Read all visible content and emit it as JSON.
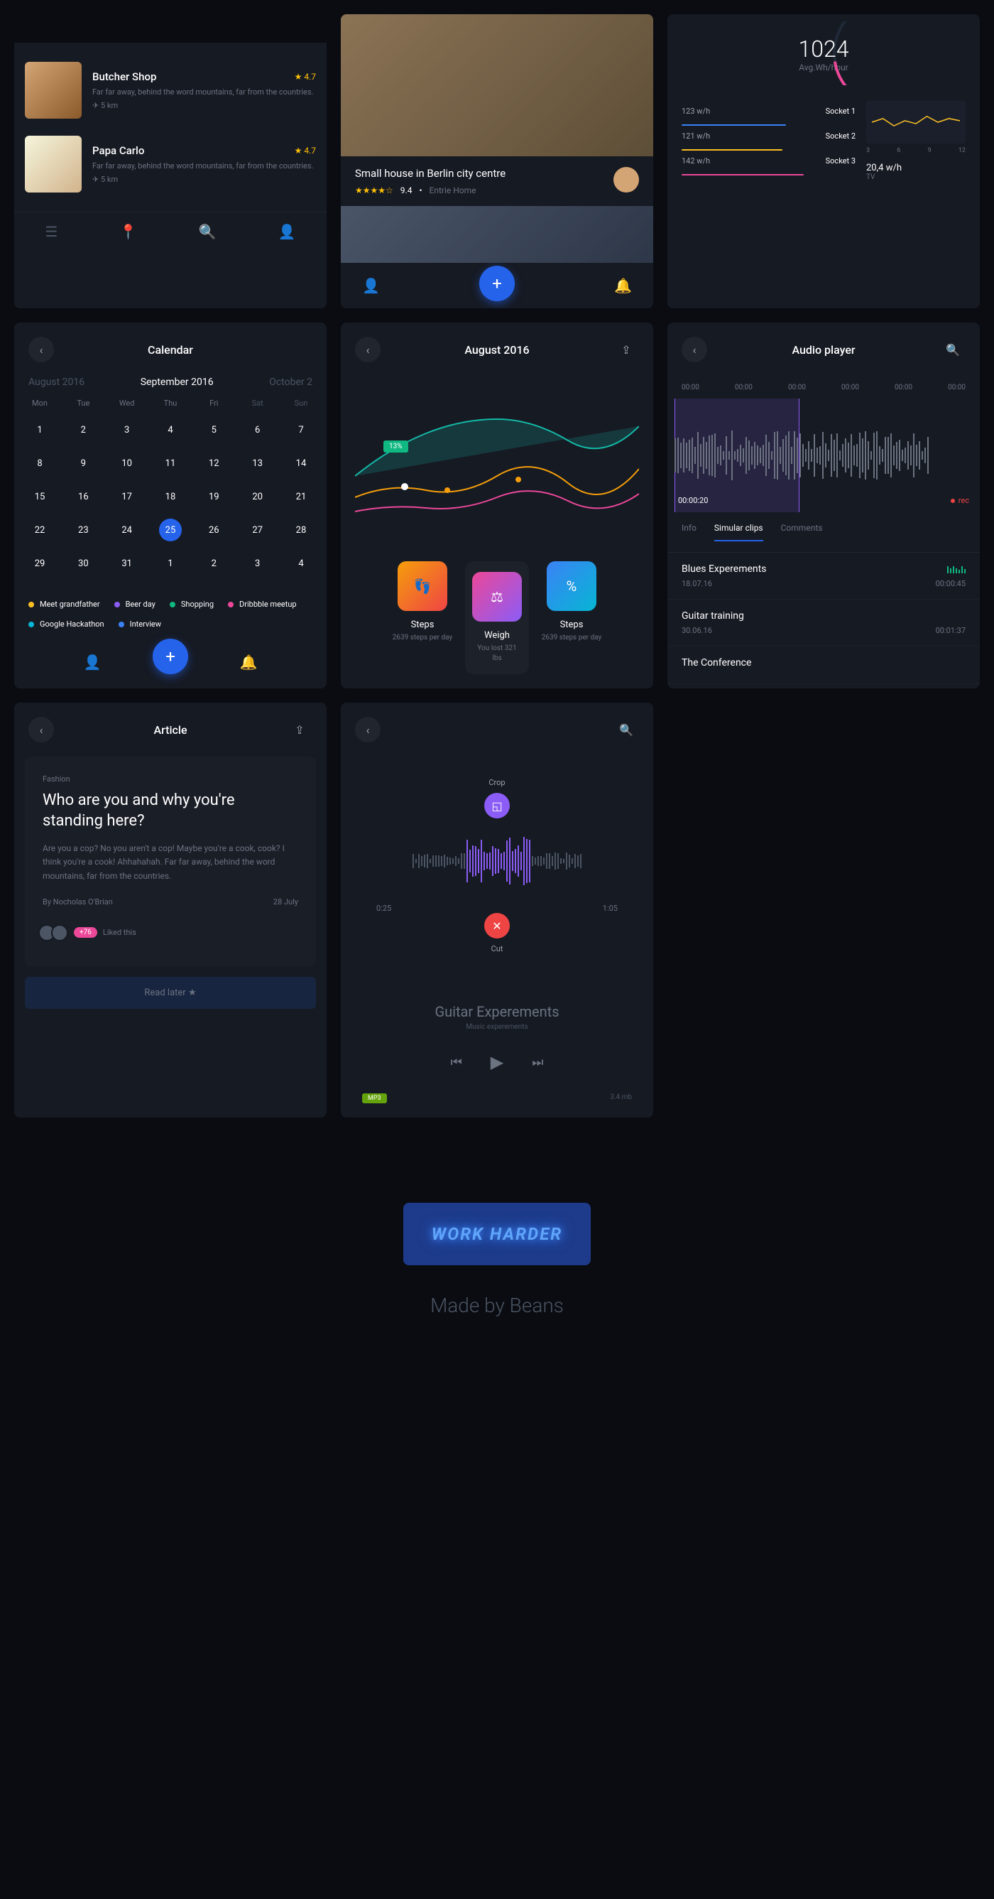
{
  "restaurants": {
    "items": [
      {
        "name": "Butcher Shop",
        "rating": "4.7",
        "desc": "Far far away, behind the word mountains, far from the countries.",
        "dist": "5 km"
      },
      {
        "name": "Papa Carlo",
        "rating": "4.7",
        "desc": "Far far away, behind the word mountains, far from the countries.",
        "dist": "5 km"
      }
    ]
  },
  "house": {
    "title": "Small house in Berlin city centre",
    "rating": "9.4",
    "type": "Entrie Home"
  },
  "energy": {
    "value": "1024",
    "label": "Avg.Wh/hour",
    "sockets": [
      {
        "val": "123 w/h",
        "name": "Socket 1",
        "color": "#3b82f6"
      },
      {
        "val": "121 w/h",
        "name": "Socket 2",
        "color": "#fbbf24"
      },
      {
        "val": "142 w/h",
        "name": "Socket 3",
        "color": "#ec4899"
      }
    ],
    "chart_labels": [
      "3",
      "6",
      "9",
      "12"
    ],
    "tv_val": "20,4 w/h",
    "tv_lbl": "TV"
  },
  "calendar": {
    "title": "Calendar",
    "months": [
      "August 2016",
      "September 2016",
      "October 2"
    ],
    "days": [
      "Mon",
      "Tue",
      "Wed",
      "Thu",
      "Fri",
      "Sat",
      "Sun"
    ],
    "weeks": [
      [
        "1",
        "2",
        "3",
        "4",
        "5",
        "6",
        "7"
      ],
      [
        "8",
        "9",
        "10",
        "11",
        "12",
        "13",
        "14"
      ],
      [
        "15",
        "16",
        "17",
        "18",
        "19",
        "20",
        "21"
      ],
      [
        "22",
        "23",
        "24",
        "25",
        "26",
        "27",
        "28"
      ],
      [
        "29",
        "30",
        "31",
        "1",
        "2",
        "3",
        "4"
      ]
    ],
    "today": "25",
    "events": [
      {
        "color": "#fbbf24",
        "label": "Meet grandfather"
      },
      {
        "color": "#8b5cf6",
        "label": "Beer day"
      },
      {
        "color": "#10b981",
        "label": "Shopping"
      },
      {
        "color": "#ec4899",
        "label": "Dribbble meetup"
      },
      {
        "color": "#06b6d4",
        "label": "Google Hackathon"
      },
      {
        "color": "#3b82f6",
        "label": "Interview"
      }
    ]
  },
  "fitness": {
    "title": "August 2016",
    "tooltip": "13%",
    "cards": [
      {
        "title": "Steps",
        "sub": "2639 steps per day"
      },
      {
        "title": "Weigh",
        "sub": "You lost 321 lbs"
      },
      {
        "title": "Steps",
        "sub": "2639 steps per day"
      }
    ]
  },
  "audio": {
    "title": "Audio player",
    "marks": [
      "00:00",
      "00:00",
      "00:00",
      "00:00",
      "00:00",
      "00:00"
    ],
    "playtime": "00:00:20",
    "rec": "rec",
    "tabs": [
      "Info",
      "Simular clips",
      "Comments"
    ],
    "tracks": [
      {
        "name": "Blues Experements",
        "date": "18.07.16",
        "dur": "00:00:45",
        "playing": true
      },
      {
        "name": "Guitar training",
        "date": "30.06.16",
        "dur": "00:01:37",
        "playing": false
      },
      {
        "name": "The Conference",
        "date": "",
        "dur": "",
        "playing": false
      }
    ]
  },
  "article": {
    "header": "Article",
    "category": "Fashion",
    "title": "Who are you and why you're standing here?",
    "text": "Are you a cop? No you aren't a cop! Maybe you're a cook, cook? I think you're a cook! Ahhahahah. Far far away, behind the word mountains, far from the countries.",
    "author": "By Nocholas O'Brian",
    "date": "28 July",
    "likes": "+76",
    "liked": "Liked this",
    "read_later": "Read later"
  },
  "editor": {
    "crop": "Crop",
    "cut": "Cut",
    "start": "0:25",
    "end": "1:05",
    "title": "Guitar Experements",
    "sub": "Music experements",
    "format": "MP3",
    "size": "3.4 mb"
  },
  "chart_data": {
    "energy_sparkline": {
      "type": "line",
      "x": [
        3,
        6,
        9,
        12
      ],
      "values": [
        18,
        22,
        16,
        20,
        19,
        23,
        18,
        21
      ]
    },
    "fitness": {
      "type": "area",
      "series": [
        {
          "name": "teal",
          "color": "#14b8a6",
          "values": [
            40,
            55,
            70,
            85,
            65,
            50,
            75,
            60
          ]
        },
        {
          "name": "orange",
          "color": "#f59e0b",
          "values": [
            30,
            35,
            45,
            40,
            50,
            42,
            55,
            48
          ]
        },
        {
          "name": "pink",
          "color": "#ec4899",
          "values": [
            20,
            25,
            30,
            35,
            28,
            40,
            32,
            38
          ]
        }
      ]
    }
  },
  "footer": {
    "neon": "WORK HARDER",
    "credit": "Made by Beans"
  }
}
